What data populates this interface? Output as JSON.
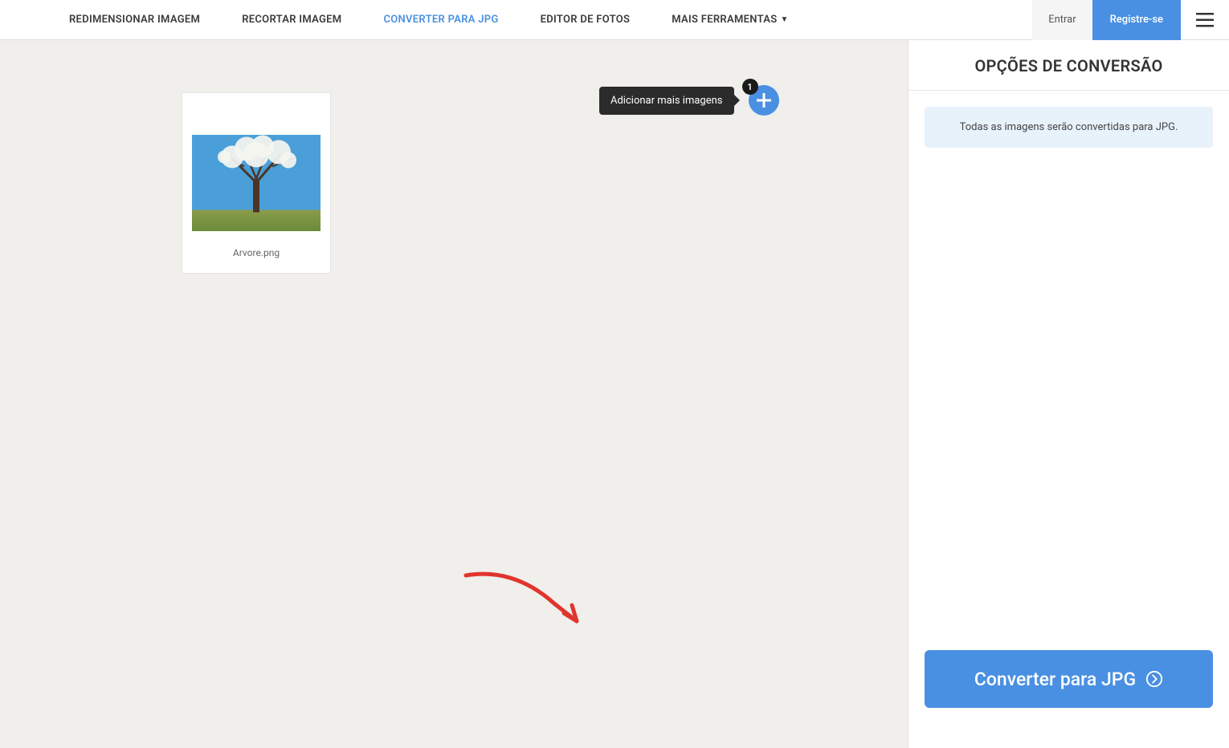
{
  "nav": {
    "items": [
      {
        "label": "REDIMENSIONAR IMAGEM"
      },
      {
        "label": "RECORTAR IMAGEM"
      },
      {
        "label": "CONVERTER PARA JPG"
      },
      {
        "label": "EDITOR DE FOTOS"
      },
      {
        "label": "MAIS FERRAMENTAS"
      }
    ],
    "login": "Entrar",
    "register": "Registre-se"
  },
  "workspace": {
    "image_name": "Arvore.png",
    "tooltip": "Adicionar mais imagens",
    "badge_count": "1"
  },
  "sidebar": {
    "title": "OPÇÕES DE CONVERSÃO",
    "info": "Todas as imagens serão convertidas para JPG.",
    "convert_label": "Converter para JPG"
  }
}
